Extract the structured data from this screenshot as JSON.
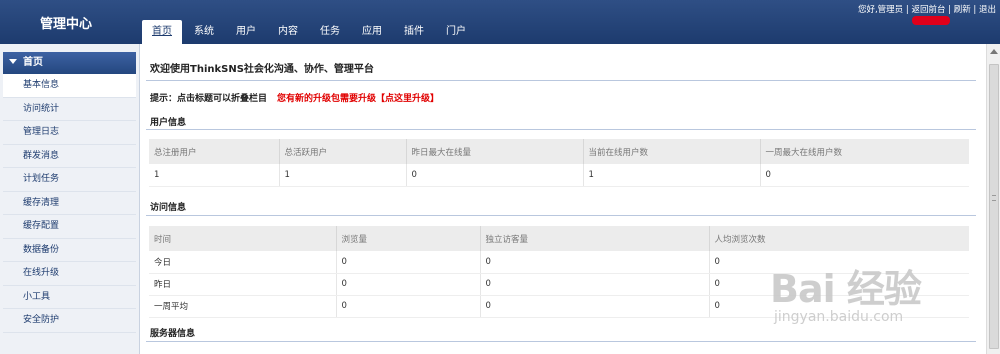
{
  "header": {
    "brand": "管理中心",
    "nav": [
      "首页",
      "系统",
      "用户",
      "内容",
      "任务",
      "应用",
      "插件",
      "门户"
    ],
    "active_nav": 0,
    "toplinks": "您好,管理员 | 返回前台 | 刷新 | 退出"
  },
  "sidebar": {
    "heading": "首页",
    "items": [
      "基本信息",
      "访问统计",
      "管理日志",
      "群发消息",
      "计划任务",
      "缓存清理",
      "缓存配置",
      "数据备份",
      "在线升级",
      "小工具",
      "安全防护"
    ],
    "active_item": 0
  },
  "main": {
    "welcome": "欢迎使用ThinkSNS社会化沟通、协作、管理平台",
    "tip_label": "提示：点击标题可以折叠栏目",
    "tip_upgrade": "您有新的升级包需要升级【点这里升级】",
    "user_info": {
      "title": "用户信息",
      "headers": [
        "总注册用户",
        "总活跃用户",
        "昨日最大在线量",
        "当前在线用户数",
        "一周最大在线用户数"
      ],
      "rows": [
        [
          "1",
          "1",
          "0",
          "1",
          "0"
        ]
      ]
    },
    "visit_info": {
      "title": "访问信息",
      "headers": [
        "时间",
        "浏览量",
        "独立访客量",
        "人均浏览次数"
      ],
      "rows": [
        [
          "今日",
          "0",
          "0",
          "0"
        ],
        [
          "昨日",
          "0",
          "0",
          "0"
        ],
        [
          "一周平均",
          "0",
          "0",
          "0"
        ]
      ]
    },
    "server_info": {
      "title": "服务器信息"
    }
  },
  "watermark": {
    "logo": "Bai 经验",
    "url": "jingyan.baidu.com"
  },
  "colors": {
    "header_bg": "#1d3b6e",
    "alert_red": "#e10000"
  }
}
